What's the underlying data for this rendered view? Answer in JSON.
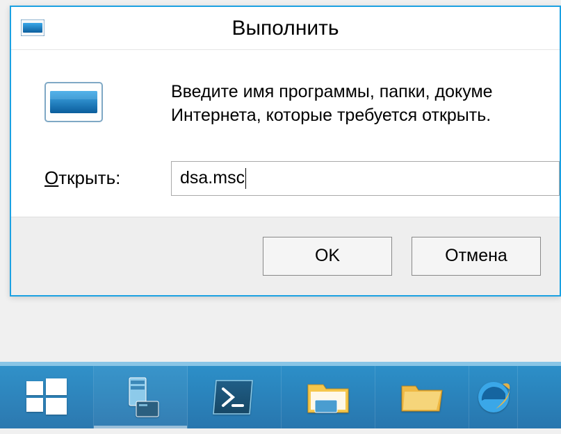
{
  "dialog": {
    "title": "Выполнить",
    "description_line1": "Введите имя программы, папки, докуме",
    "description_line2": "Интернета, которые требуется открыть.",
    "open_label_prefix": "О",
    "open_label_rest": "ткрыть:",
    "input_value": "dsa.msc",
    "ok_label": "OK",
    "cancel_label": "Отмена"
  },
  "taskbar": {
    "items": [
      {
        "name": "start",
        "icon": "windows-start-icon"
      },
      {
        "name": "server-manager",
        "icon": "server-manager-icon"
      },
      {
        "name": "powershell",
        "icon": "powershell-icon"
      },
      {
        "name": "explorer",
        "icon": "file-explorer-icon"
      },
      {
        "name": "library",
        "icon": "library-icon"
      },
      {
        "name": "ie",
        "icon": "internet-explorer-icon"
      }
    ]
  }
}
